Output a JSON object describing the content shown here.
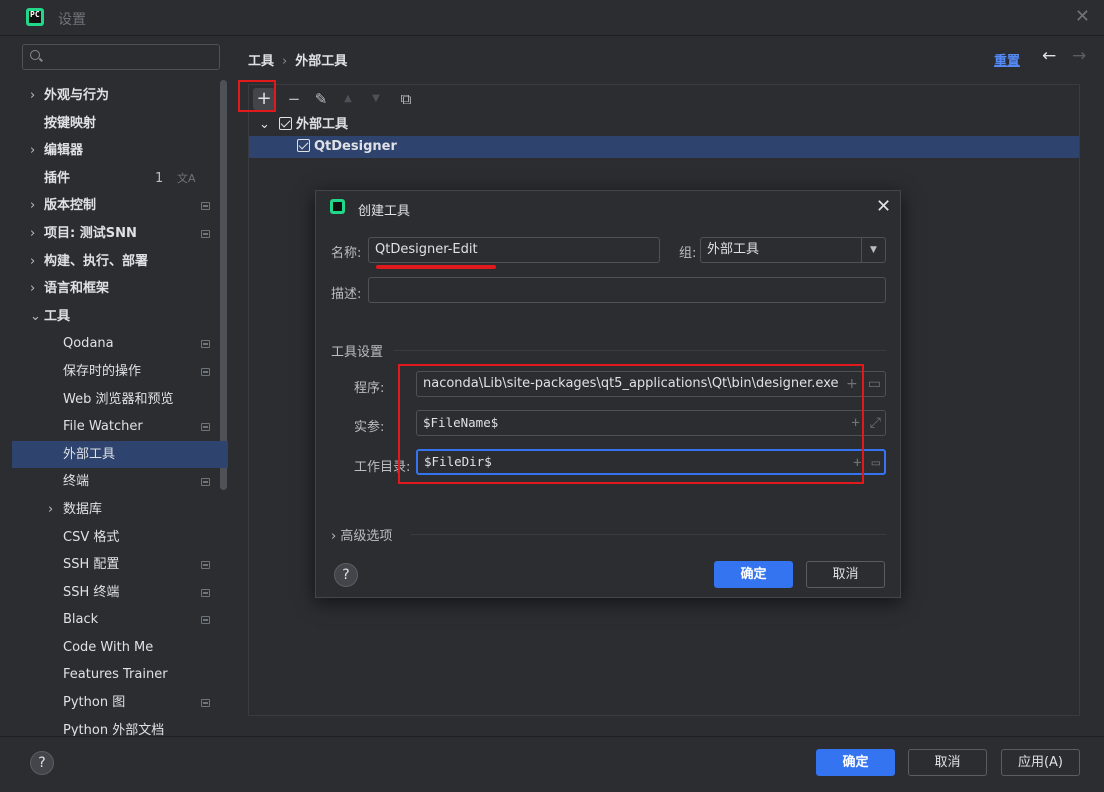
{
  "window": {
    "title": "设置",
    "app_icon": "pycharm-icon",
    "close_glyph": "✕"
  },
  "search": {
    "placeholder": ""
  },
  "sidebar": {
    "items": [
      {
        "label": "外观与行为",
        "chevron": "›",
        "bold": true
      },
      {
        "label": "按键映射",
        "bold": true
      },
      {
        "label": "编辑器",
        "chevron": "›",
        "bold": true
      },
      {
        "label": "插件",
        "bold": true,
        "count": "1"
      },
      {
        "label": "版本控制",
        "chevron": "›",
        "bold": true
      },
      {
        "label": "项目: 测试SNN",
        "chevron": "›",
        "bold": true
      },
      {
        "label": "构建、执行、部署",
        "chevron": "›",
        "bold": true
      },
      {
        "label": "语言和框架",
        "chevron": "›",
        "bold": true
      },
      {
        "label": "工具",
        "chevron": "⌄",
        "bold": true
      },
      {
        "label": "Qodana"
      },
      {
        "label": "保存时的操作"
      },
      {
        "label": "Web 浏览器和预览"
      },
      {
        "label": "File Watcher"
      },
      {
        "label": "外部工具"
      },
      {
        "label": "终端"
      },
      {
        "label": "数据库",
        "chevron": "›"
      },
      {
        "label": "CSV 格式"
      },
      {
        "label": "SSH 配置"
      },
      {
        "label": "SSH 终端"
      },
      {
        "label": "Black"
      },
      {
        "label": "Code With Me"
      },
      {
        "label": "Features Trainer"
      },
      {
        "label": "Python 图"
      },
      {
        "label": "Python 外部文档"
      }
    ]
  },
  "header": {
    "breadcrumb": [
      "工具",
      "外部工具"
    ],
    "breadcrumb_sep": "›",
    "reset_label": "重置",
    "back_glyph": "←",
    "forward_glyph": "→"
  },
  "toolbar": {
    "add": "+",
    "remove": "−",
    "edit": "✎",
    "up": "▲",
    "down": "▼",
    "copy": "⧉"
  },
  "tools_tree": {
    "group": {
      "chevron": "⌄",
      "label": "外部工具",
      "checked": true
    },
    "items": [
      {
        "label": "QtDesigner",
        "checked": true
      }
    ]
  },
  "dialog": {
    "title": "创建工具",
    "close_glyph": "✕",
    "name_label": "名称:",
    "name_value": "QtDesigner-Edit",
    "group_label": "组:",
    "group_value": "外部工具",
    "group_arrow": "▼",
    "desc_label": "描述:",
    "desc_value": "",
    "section_title": "工具设置",
    "program_label": "程序:",
    "program_value": "naconda\\Lib\\site-packages\\qt5_applications\\Qt\\bin\\designer.exe",
    "args_label": "实参:",
    "args_value": "$FileName$",
    "workdir_label": "工作目录:",
    "workdir_value": "$FileDir$",
    "field_plus": "+",
    "advanced_chevron": "›",
    "advanced_label": "高级选项",
    "help_glyph": "?",
    "ok_label": "确定",
    "cancel_label": "取消"
  },
  "footer": {
    "help_glyph": "?",
    "ok_label": "确定",
    "cancel_label": "取消",
    "apply_label": "应用(A)"
  },
  "colors": {
    "background": "#2b2d30",
    "selection": "#2e436e",
    "accent": "#3574f0",
    "link": "#548af7",
    "annotation_red": "#e0191c",
    "text": "#dfe1e5"
  }
}
